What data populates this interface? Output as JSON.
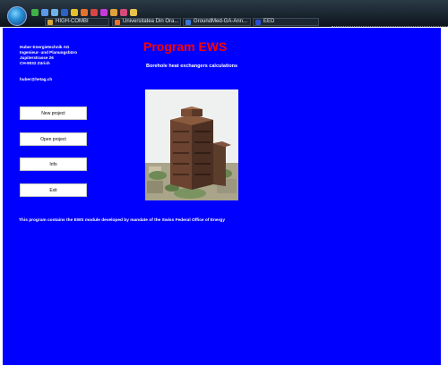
{
  "taskbar": {
    "tasks": [
      {
        "label": "HIGH-COMBI",
        "icon": "folder-icon",
        "color": "#d9a83a"
      },
      {
        "label": "Universitatea Din Ora...",
        "icon": "firefox-icon",
        "color": "#e8722a"
      },
      {
        "label": "GroundMed-GA-Ann...",
        "icon": "document-icon",
        "color": "#3a78d9"
      },
      {
        "label": "EED",
        "icon": "app-icon",
        "color": "#2a4fd6"
      }
    ]
  },
  "org": {
    "lines": [
      "Huber Energietechnik AG",
      "Ingenieur- und Planungsbüro",
      "Jupiterstrasse 26",
      "CH-8032 Zürich"
    ],
    "email": "huber@hetag.ch"
  },
  "header": {
    "title": "Program EWS",
    "subtitle": "Borehole heat exchangers calculations"
  },
  "buttons": {
    "new_project": "New project",
    "open_project": "Open project",
    "info": "Info",
    "exit": "Exit"
  },
  "footer": {
    "text": "This program contains the EWS module developed by mandate of the Swiss Federal Office of Energy"
  },
  "colors": {
    "background": "#0000ff",
    "title": "#ff0000",
    "text": "#ffffff"
  }
}
